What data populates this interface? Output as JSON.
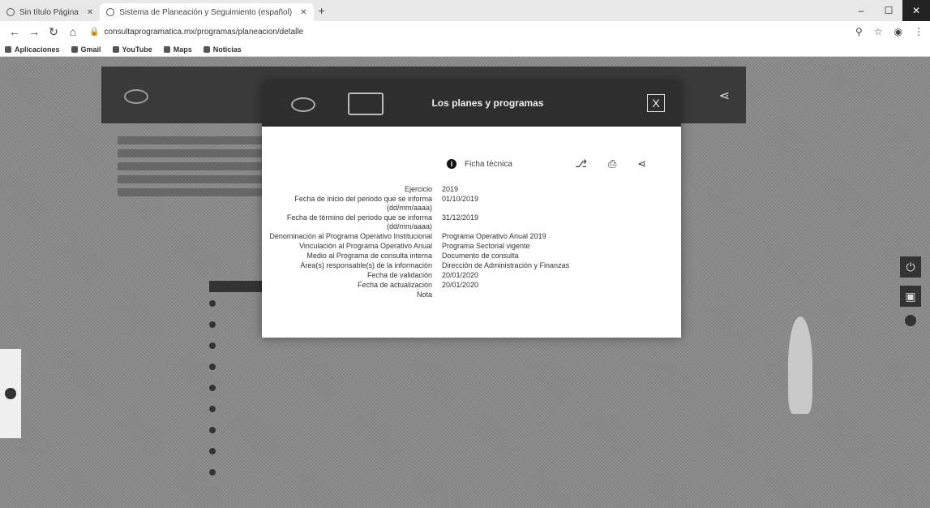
{
  "browser": {
    "tabs": [
      {
        "label": "Sin título Página",
        "active": false
      },
      {
        "label": "Sistema de Planeación y Seguimiento (español)",
        "active": true
      }
    ],
    "new_tab": "+",
    "url": "consultaprogramatica.mx/programas/planeacion/detalle",
    "bookmarks": [
      "Aplicaciones",
      "Gmail",
      "YouTube",
      "Maps",
      "Noticias"
    ]
  },
  "modal": {
    "title": "Los planes y programas",
    "close_label": "X",
    "info_label": "Ficha técnica",
    "fields": [
      {
        "label": "Ejercicio",
        "value": "2019"
      },
      {
        "label": "Fecha de inicio del periodo que se informa (dd/mm/aaaa)",
        "value": "01/10/2019"
      },
      {
        "label": "Fecha de término del periodo que se informa (dd/mm/aaaa)",
        "value": "31/12/2019"
      },
      {
        "label": "Denominación al Programa Operativo Institucional",
        "value": "Programa Operativo Anual 2019"
      },
      {
        "label": "Vinculación al Programa Operativo Anual",
        "value": "Programa Sectorial vigente"
      },
      {
        "label": "Medio al Programa de consulta interna",
        "value": "Documento de consulta"
      },
      {
        "label": "Área(s) responsable(s) de la información",
        "value": "Dirección de Administración y Finanzas"
      },
      {
        "label": "Fecha de validación",
        "value": "20/01/2020"
      },
      {
        "label": "Fecha de actualización",
        "value": "20/01/2020"
      },
      {
        "label": "Nota",
        "value": ""
      }
    ]
  }
}
